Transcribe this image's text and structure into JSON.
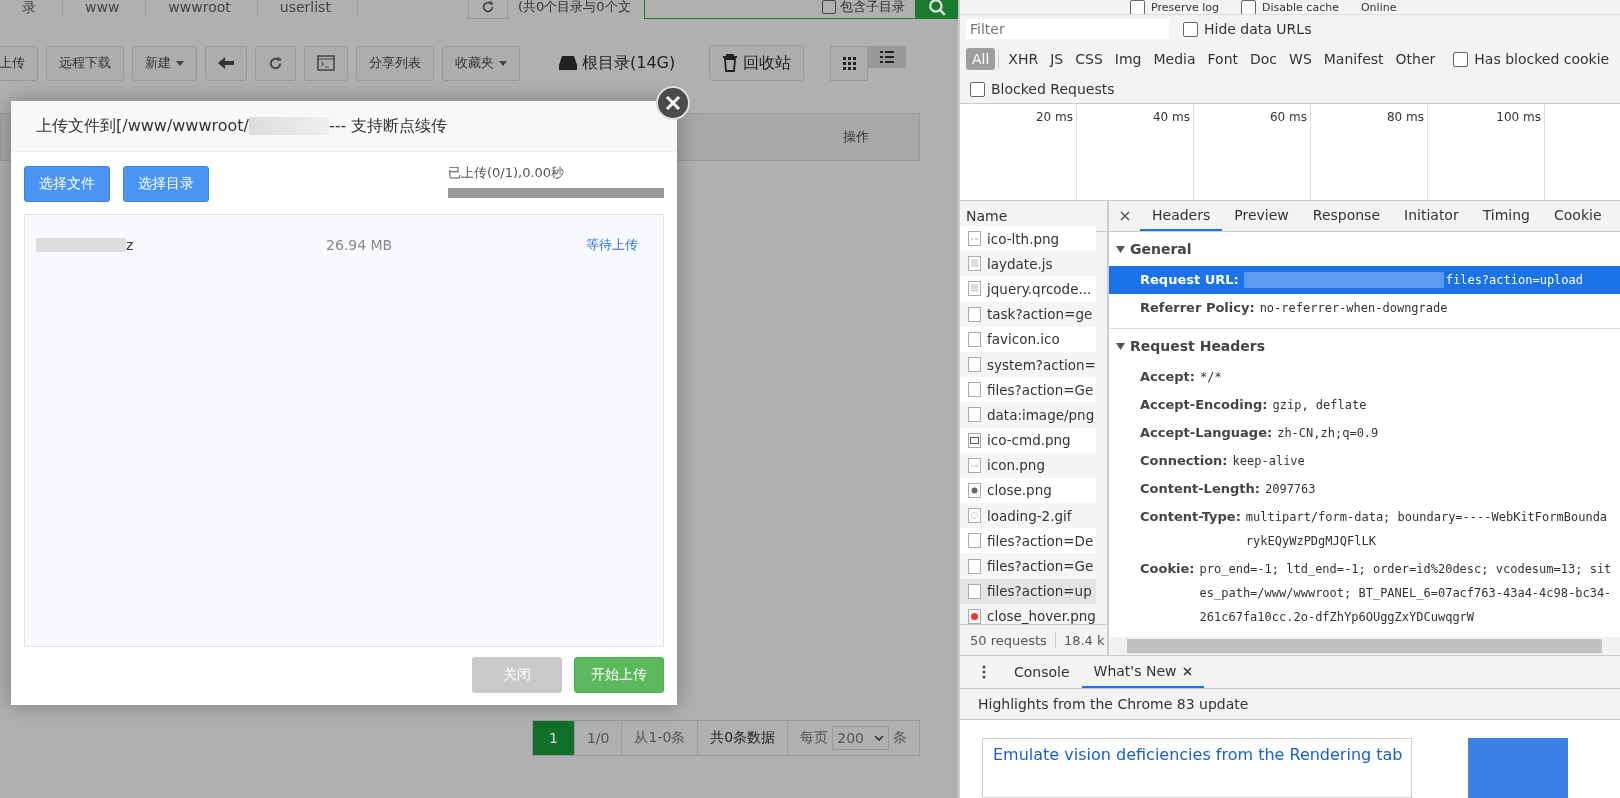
{
  "file_manager": {
    "breadcrumb": [
      "录",
      "www",
      "wwwroot",
      "userlist"
    ],
    "summary": "(共0个目录与0个文",
    "search": {
      "subdir_checkbox": {
        "label": "包含子目录",
        "checked": false
      }
    },
    "toolbar": [
      {
        "kind": "text",
        "label": "上传"
      },
      {
        "kind": "text",
        "label": "远程下载"
      },
      {
        "kind": "dropdown",
        "label": "新建"
      },
      {
        "kind": "back"
      },
      {
        "kind": "refresh"
      },
      {
        "kind": "terminal"
      },
      {
        "kind": "text",
        "label": "分享列表"
      },
      {
        "kind": "dropdown",
        "label": "收藏夹"
      }
    ],
    "disk": "根目录(14G)",
    "recycle": "回收站",
    "views": [
      {
        "kind": "grid",
        "selected": false
      },
      {
        "kind": "list",
        "selected": true
      }
    ],
    "table_header": "操作",
    "pagination": {
      "pages": [
        {
          "label": "1",
          "selected": true
        }
      ],
      "page_info": "1/0",
      "range": "从1-0条",
      "total": "共0条数据",
      "per_page_label": "每页",
      "per_page": "200",
      "unit": "条"
    }
  },
  "upload_dialog": {
    "title_prefix": "上传文件到[/www/wwwroot/",
    "title_suffix": "--- 支持断点续传",
    "buttons": [
      "选择文件",
      "选择目录"
    ],
    "progress_text": "已上传(0/1),0.00秒",
    "level": 0,
    "files": [
      {
        "name_suffix": "z",
        "size": "26.94 MB",
        "status": "等待上传"
      }
    ],
    "footer": [
      {
        "label": "关闭",
        "disabled": true
      },
      {
        "label": "开始上传",
        "disabled": false
      }
    ]
  },
  "devtools": {
    "top_options": [
      {
        "label": "Preserve log",
        "checked": false
      },
      {
        "label": "Disable cache",
        "checked": false
      }
    ],
    "throttle": "Online",
    "filter": {
      "placeholder": "Filter"
    },
    "hide_data_urls": {
      "label": "Hide data URLs",
      "checked": false
    },
    "types": [
      {
        "label": "All",
        "selected": true
      },
      {
        "label": "XHR",
        "selected": false
      },
      {
        "label": "JS",
        "selected": false
      },
      {
        "label": "CSS",
        "selected": false
      },
      {
        "label": "Img",
        "selected": false
      },
      {
        "label": "Media",
        "selected": false
      },
      {
        "label": "Font",
        "selected": false
      },
      {
        "label": "Doc",
        "selected": false
      },
      {
        "label": "WS",
        "selected": false
      },
      {
        "label": "Manifest",
        "selected": false
      },
      {
        "label": "Other",
        "selected": false
      }
    ],
    "has_blocked_cookies": {
      "label": "Has blocked cookie",
      "checked": false
    },
    "blocked_requests": {
      "label": "Blocked Requests",
      "checked": false
    },
    "timeline_ticks": [
      "20 ms",
      "40 ms",
      "60 ms",
      "80 ms",
      "100 ms"
    ],
    "name_header": "Name",
    "requests": [
      {
        "name": "ico-lth.png",
        "kind": "image",
        "selected": false
      },
      {
        "name": "laydate.js",
        "kind": "script",
        "selected": false
      },
      {
        "name": "jquery.qrcode...",
        "kind": "script",
        "selected": false
      },
      {
        "name": "task?action=ge",
        "kind": "blank",
        "selected": false
      },
      {
        "name": "favicon.ico",
        "kind": "blank",
        "selected": false
      },
      {
        "name": "system?action=",
        "kind": "blank",
        "selected": false
      },
      {
        "name": "files?action=Ge",
        "kind": "blank",
        "selected": false
      },
      {
        "name": "data:image/png",
        "kind": "blank",
        "selected": false
      },
      {
        "name": "ico-cmd.png",
        "kind": "terminal",
        "selected": false
      },
      {
        "name": "icon.png",
        "kind": "image",
        "selected": false
      },
      {
        "name": "close.png",
        "kind": "close",
        "selected": false
      },
      {
        "name": "loading-2.gif",
        "kind": "spinner",
        "selected": false
      },
      {
        "name": "files?action=De",
        "kind": "blank",
        "selected": false
      },
      {
        "name": "files?action=Ge",
        "kind": "blank",
        "selected": false
      },
      {
        "name": "files?action=up",
        "kind": "blank",
        "selected": true
      },
      {
        "name": "close_hover.png",
        "kind": "close-red",
        "selected": false
      }
    ],
    "status": {
      "requests": "50 requests",
      "size": "18.4 k"
    },
    "detail_tabs": [
      {
        "label": "Headers",
        "selected": true
      },
      {
        "label": "Preview",
        "selected": false
      },
      {
        "label": "Response",
        "selected": false
      },
      {
        "label": "Initiator",
        "selected": false
      },
      {
        "label": "Timing",
        "selected": false
      },
      {
        "label": "Cookie",
        "selected": false
      }
    ],
    "general": {
      "title": "General",
      "expanded": true,
      "rows": [
        {
          "name": "Request URL:",
          "value": "files?action=upload",
          "selected": true,
          "blurred": true
        },
        {
          "name": "Referrer Policy:",
          "value": "no-referrer-when-downgrade",
          "selected": false,
          "blurred": false
        }
      ]
    },
    "request_headers": {
      "title": "Request Headers",
      "expanded": true,
      "rows": [
        {
          "name": "Accept:",
          "value": "*/*"
        },
        {
          "name": "Accept-Encoding:",
          "value": "gzip, deflate"
        },
        {
          "name": "Accept-Language:",
          "value": "zh-CN,zh;q=0.9"
        },
        {
          "name": "Connection:",
          "value": "keep-alive"
        },
        {
          "name": "Content-Length:",
          "value": "2097763"
        },
        {
          "name": "Content-Type:",
          "value": "multipart/form-data; boundary=----WebKitFormBoundarykEQyWzPDgMJQFlLK"
        },
        {
          "name": "Cookie:",
          "value": "pro_end=-1; ltd_end=-1; order=id%20desc; vcodesum=13; sites_path=/www/wwwroot; BT_PANEL_6=07acf763-43a4-4c98-bc34-261c67fa10cc.2o-dfZhYp6OUggZxYDCuwqgrW"
        }
      ]
    },
    "drawer_tabs": [
      {
        "label": "Console",
        "selected": false,
        "closable": false
      },
      {
        "label": "What's New",
        "selected": true,
        "closable": true
      }
    ],
    "highlights": "Highlights from the Chrome 83 update",
    "card_link": "Emulate vision deficiencies from the Rendering tab"
  }
}
